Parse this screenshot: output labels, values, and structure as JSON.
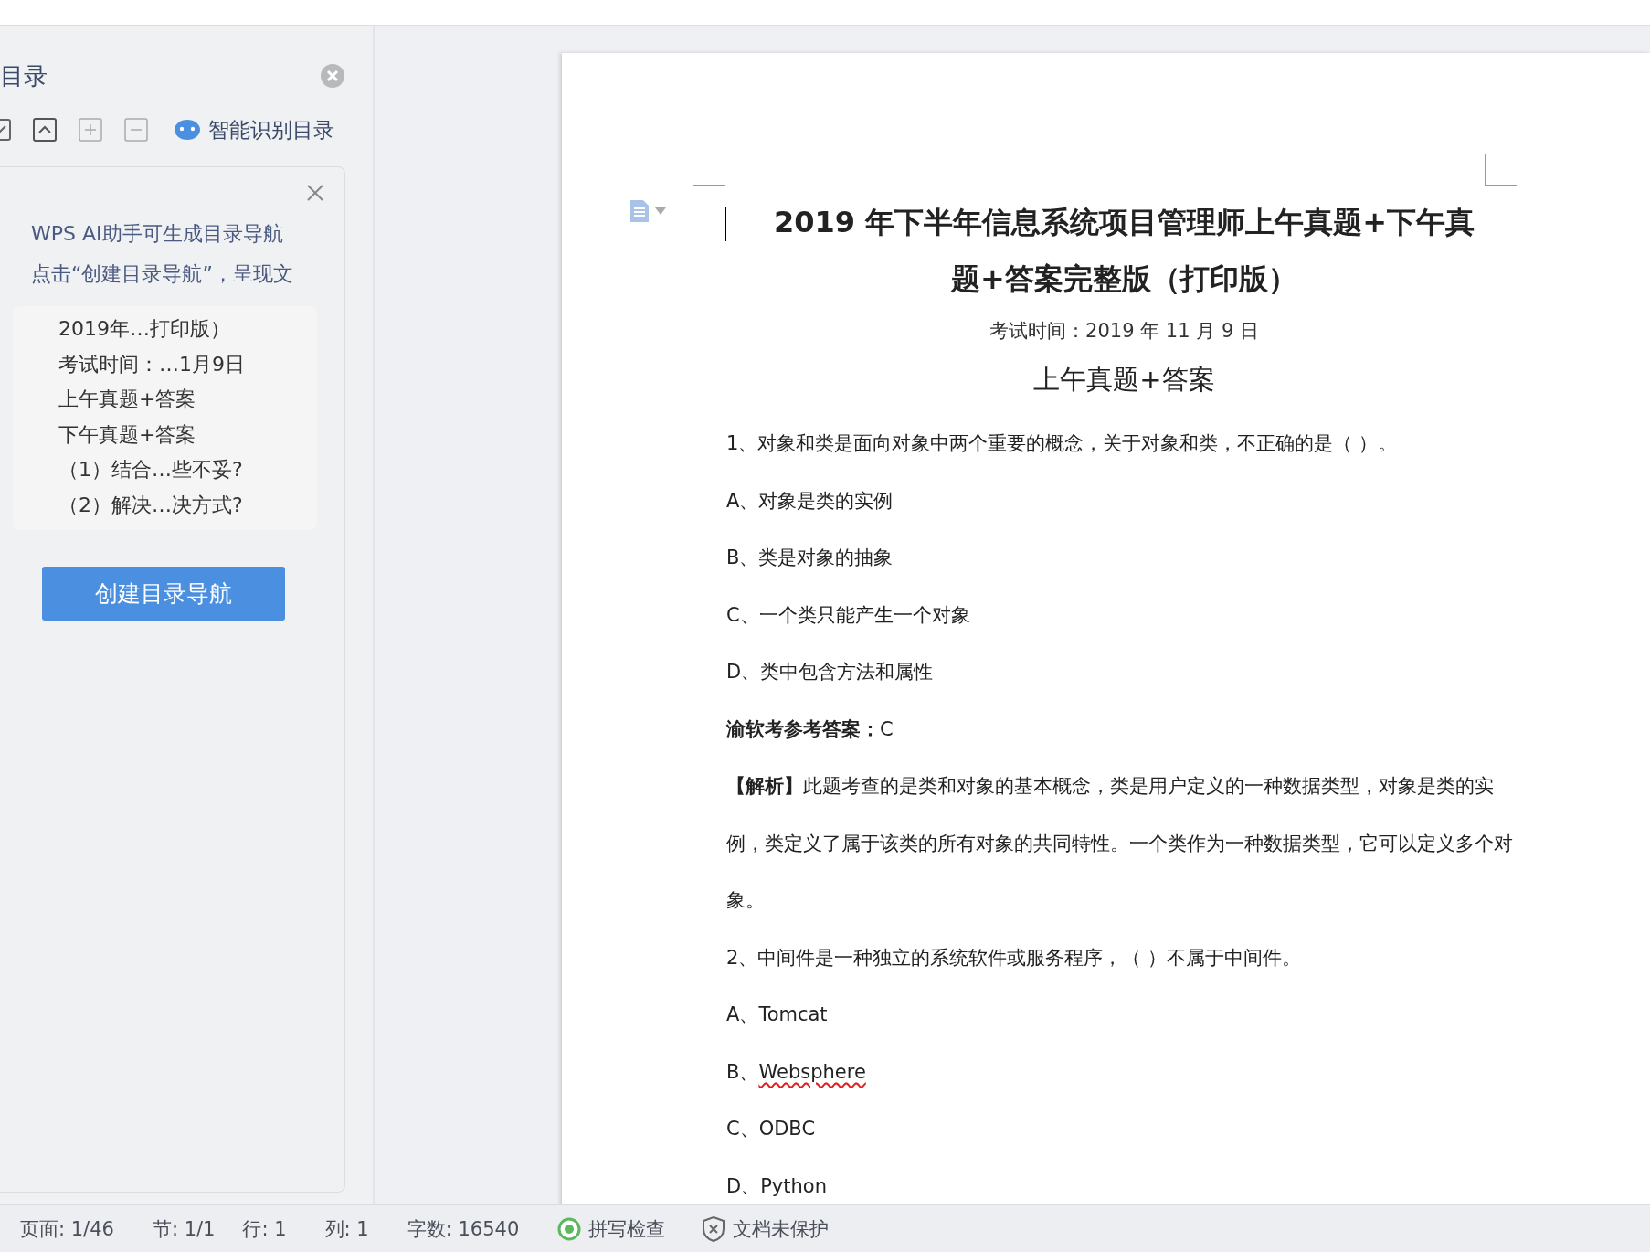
{
  "navigation_panel": {
    "title": "目录",
    "toolbar_action": "智能识别目录",
    "ai_tip": {
      "lines": [
        "WPS AI助手可生成目录导航",
        "点击“创建目录导航”，呈现文"
      ]
    },
    "toc_items": [
      "2019年…打印版）",
      "考试时间：…1月9日",
      "上午真题+答案",
      "下午真题+答案",
      "（1）结合…些不妥?",
      "（2）解决…决方式?"
    ],
    "create_button": "创建目录导航"
  },
  "document": {
    "title": "2019 年下半年信息系统项目管理师上午真题+下午真题+答案完整版（打印版）",
    "exam_time": "考试时间：2019 年 11 月 9 日",
    "section_heading": "上午真题+答案",
    "paragraphs": [
      {
        "kind": "question",
        "text": "1、对象和类是面向对象中两个重要的概念，关于对象和类，不正确的是（  ）。"
      },
      {
        "kind": "option",
        "marker": "A、",
        "text": "对象是类的实例",
        "misspelled": false
      },
      {
        "kind": "option",
        "marker": "B、",
        "text": "类是对象的抽象",
        "misspelled": false
      },
      {
        "kind": "option",
        "marker": "C、",
        "text": "一个类只能产生一个对象",
        "misspelled": false
      },
      {
        "kind": "option",
        "marker": "D、",
        "text": "类中包含方法和属性",
        "misspelled": false
      },
      {
        "kind": "answer",
        "text": "**渝软考参考答案：**C"
      },
      {
        "kind": "analysis",
        "text": "**【解析】**此题考查的是类和对象的基本概念，类是用户定义的一种数据类型，对象是类的实例，类定义了属于该类的所有对象的共同特性。一个类作为一种数据类型，它可以定义多个对象。"
      },
      {
        "kind": "question",
        "text": "2、中间件是一种独立的系统软件或服务程序，（  ）不属于中间件。"
      },
      {
        "kind": "option",
        "marker": "A、",
        "text": "Tomcat",
        "misspelled": false
      },
      {
        "kind": "option",
        "marker": "B、",
        "text": "Websphere",
        "misspelled": true
      },
      {
        "kind": "option",
        "marker": "C、",
        "text": "ODBC",
        "misspelled": false
      },
      {
        "kind": "option",
        "marker": "D、",
        "text": "Python",
        "misspelled": false
      }
    ]
  },
  "status_bar": {
    "items": [
      "页面: 1/46",
      "节: 1/1",
      "行: 1",
      "列: 1",
      "字数: 16540"
    ],
    "spell_check": "拼写检查",
    "protection": "文档未保护"
  }
}
